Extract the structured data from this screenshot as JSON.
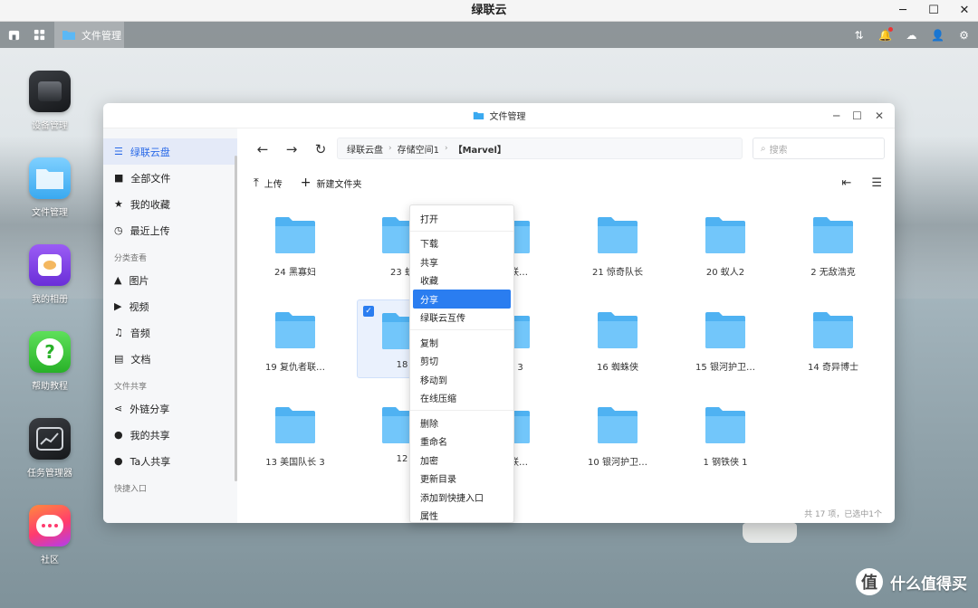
{
  "window": {
    "title": "绿联云"
  },
  "taskbar": {
    "app_label": "文件管理"
  },
  "desktop": {
    "icons": [
      {
        "label": "设备管理"
      },
      {
        "label": "文件管理"
      },
      {
        "label": "我的相册"
      },
      {
        "label": "帮助教程"
      },
      {
        "label": "任务管理器"
      },
      {
        "label": "社区"
      }
    ]
  },
  "file_manager": {
    "title": "文件管理",
    "sidebar": {
      "items": [
        {
          "label": "绿联云盘"
        },
        {
          "label": "全部文件"
        },
        {
          "label": "我的收藏"
        },
        {
          "label": "最近上传"
        }
      ],
      "section_category": "分类查看",
      "category_items": [
        {
          "label": "图片"
        },
        {
          "label": "视频"
        },
        {
          "label": "音频"
        },
        {
          "label": "文档"
        }
      ],
      "section_share": "文件共享",
      "share_items": [
        {
          "label": "外链分享"
        },
        {
          "label": "我的共享"
        },
        {
          "label": "Ta人共享"
        }
      ],
      "section_quick": "快捷入口"
    },
    "breadcrumb": [
      "绿联云盘",
      "存储空间1",
      "【Marvel】"
    ],
    "search_placeholder": "搜索",
    "toolbar": {
      "upload": "上传",
      "new_folder": "新建文件夹"
    },
    "folders": [
      {
        "name": "24 黑寡妇"
      },
      {
        "name": "23 蚁"
      },
      {
        "name": "仇者联…"
      },
      {
        "name": "21 惊奇队长"
      },
      {
        "name": "20 蚁人2"
      },
      {
        "name": "2 无敌浩克"
      },
      {
        "name": "19 复仇者联…"
      },
      {
        "name": "18"
      },
      {
        "name": "雷神 3"
      },
      {
        "name": "16 蜘蛛侠"
      },
      {
        "name": "15 银河护卫…"
      },
      {
        "name": "14 奇异博士"
      },
      {
        "name": "13 美国队长 3"
      },
      {
        "name": "12"
      },
      {
        "name": "仇者联…"
      },
      {
        "name": "10 银河护卫…"
      },
      {
        "name": "1 钢铁侠 1"
      }
    ],
    "status": "共 17 项，已选中1个"
  },
  "context_menu": {
    "groups": [
      [
        "打开"
      ],
      [
        "下载",
        "共享",
        "收藏",
        "分享",
        "绿联云互传"
      ],
      [
        "复制",
        "剪切",
        "移动到",
        "在线压缩"
      ],
      [
        "删除",
        "重命名",
        "加密",
        "更新目录",
        "添加到快捷入口",
        "属性"
      ]
    ],
    "highlighted": "分享"
  },
  "watermark": {
    "text": "什么值得买",
    "logo": "值"
  },
  "colors": {
    "accent": "#2a7df0",
    "folder": "#5bb8f5",
    "sidebar_active": "#e4eaf8"
  }
}
